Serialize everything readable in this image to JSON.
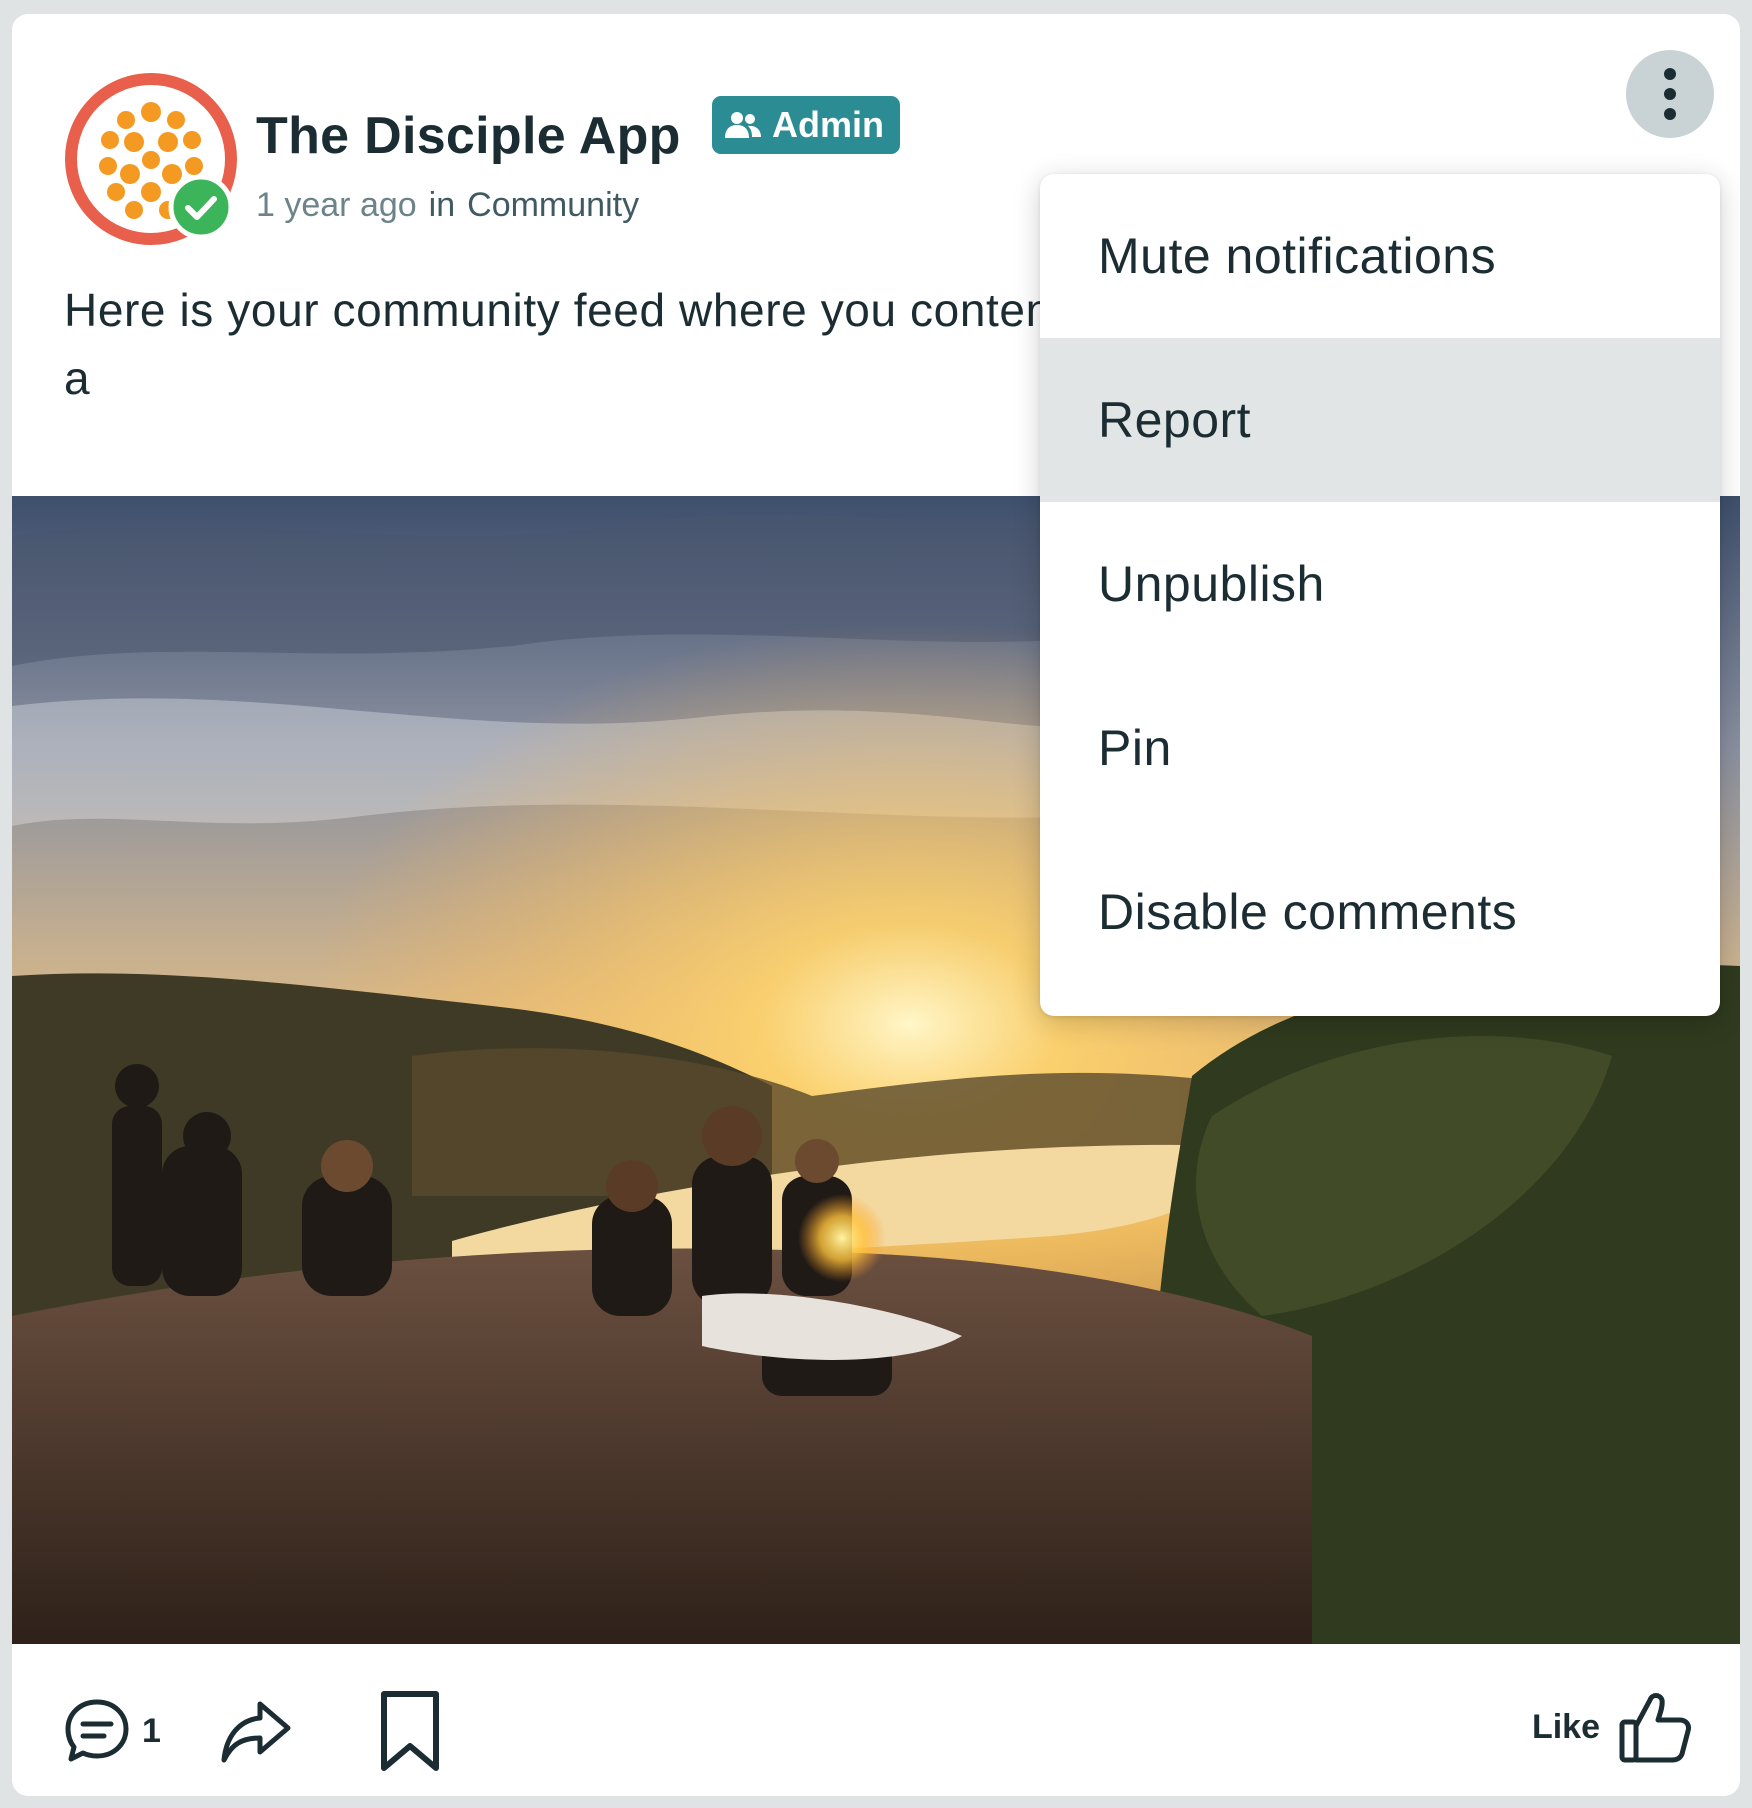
{
  "post": {
    "author": "The Disciple App",
    "badge": "Admin",
    "time": "1 year ago",
    "in_word": "in",
    "channel": "Community",
    "text": "Here is your community feed where you content including images, gifs, videos a"
  },
  "menu": {
    "items": [
      {
        "label": "Mute notifications"
      },
      {
        "label": "Report",
        "highlighted": true
      },
      {
        "label": "Unpublish"
      },
      {
        "label": "Pin"
      },
      {
        "label": "Disable comments"
      }
    ]
  },
  "footer": {
    "comment_count": "1",
    "like_label": "Like"
  },
  "icons": {
    "avatar": "disciple-app-logo",
    "verified": "checkmark-icon",
    "badge": "people-icon",
    "more": "kebab-vertical-icon",
    "comment": "comment-icon",
    "share": "share-icon",
    "bookmark": "bookmark-icon",
    "like": "thumbs-up-icon"
  },
  "colors": {
    "accent": "#2b8c93",
    "logo_ring": "#e8604c",
    "logo_fruit": "#f49a22",
    "verified": "#3cb55a",
    "text": "#1b2d33",
    "menu_highlight": "#e1e5e6"
  }
}
